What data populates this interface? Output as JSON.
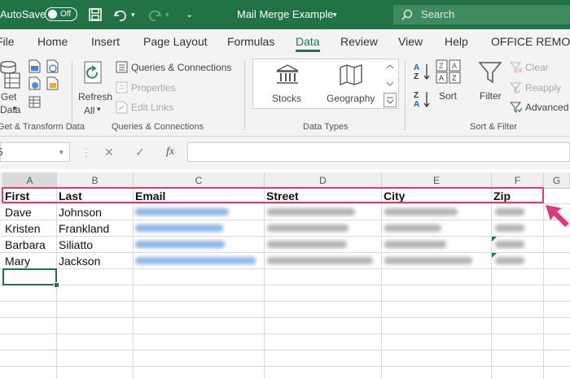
{
  "titlebar": {
    "autosave_label": "AutoSave",
    "autosave_state": "Off",
    "doc_title": "Mail Merge Example",
    "search_placeholder": "Search"
  },
  "menu": [
    "File",
    "Home",
    "Insert",
    "Page Layout",
    "Formulas",
    "Data",
    "Review",
    "View",
    "Help",
    "OFFICE REMOTE"
  ],
  "menu_active": "Data",
  "ribbon": {
    "get_data": {
      "line1": "Get",
      "line2": "Data"
    },
    "group_get_transform": "Get & Transform Data",
    "refresh": {
      "line1": "Refresh",
      "line2": "All"
    },
    "queries_connections": "Queries & Connections",
    "properties": "Properties",
    "edit_links": "Edit Links",
    "group_queries": "Queries & Connections",
    "stocks": "Stocks",
    "geography": "Geography",
    "group_data_types": "Data Types",
    "sort": "Sort",
    "filter": "Filter",
    "clear": "Clear",
    "reapply": "Reapply",
    "advanced": "Advanced",
    "group_sort_filter": "Sort & Filter"
  },
  "formula_bar": {
    "fx_label": "fx",
    "cancel_glyph": "✕",
    "enter_glyph": "✓"
  },
  "columns": [
    "A",
    "B",
    "C",
    "D",
    "E",
    "F"
  ],
  "headers": {
    "a": "First",
    "b": "Last",
    "c": "Email",
    "d": "Street",
    "e": "City",
    "f": "Zip"
  },
  "rows": [
    {
      "first": "Dave",
      "last": "Johnson"
    },
    {
      "first": "Kristen",
      "last": "Frankland"
    },
    {
      "first": "Barbara",
      "last": "Siliatto"
    },
    {
      "first": "Mary",
      "last": "Jackson"
    }
  ],
  "colors": {
    "excel_green": "#217346",
    "highlight": "#e0367a"
  }
}
